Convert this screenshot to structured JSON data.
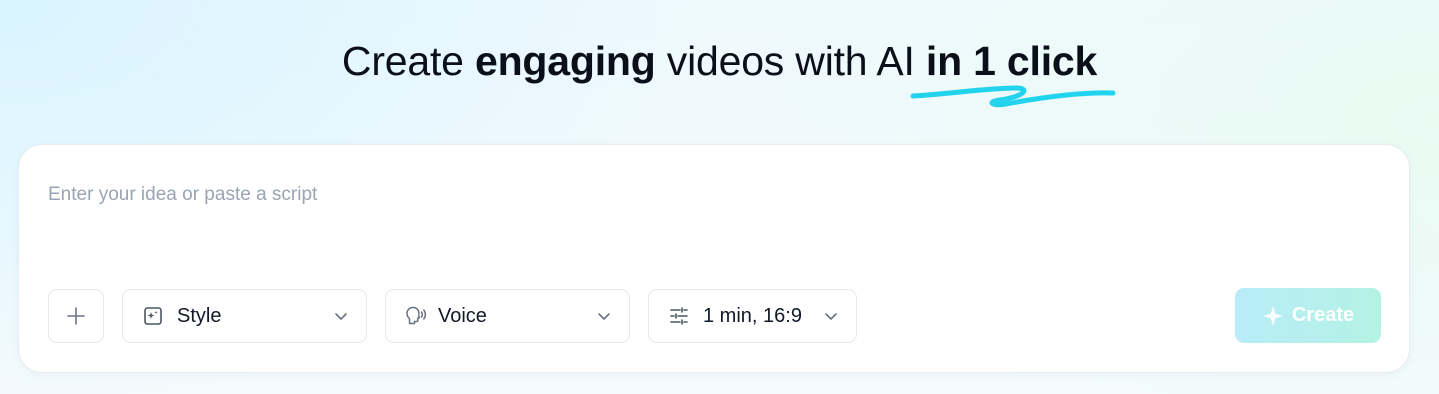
{
  "headline": {
    "part1": "Create ",
    "part2": "engaging",
    "part3": " videos with AI ",
    "accent": "in 1 click"
  },
  "prompt": {
    "placeholder": "Enter your idea or paste a script",
    "value": ""
  },
  "toolbar": {
    "add_icon": "plus-icon",
    "style": {
      "label": "Style",
      "icon": "sparkle-frame-icon"
    },
    "voice": {
      "label": "Voice",
      "icon": "speaking-head-icon"
    },
    "duration": {
      "label": "1 min, 16:9",
      "icon": "sliders-icon"
    }
  },
  "create_button": {
    "label": "Create",
    "icon": "sparkle-icon"
  },
  "colors": {
    "squiggle": "#22d3ee",
    "create_gradient_start": "#b9ecf9",
    "create_gradient_end": "#b3f2e3",
    "text_dark": "#0b0f1a",
    "placeholder": "#9aa4b2"
  }
}
